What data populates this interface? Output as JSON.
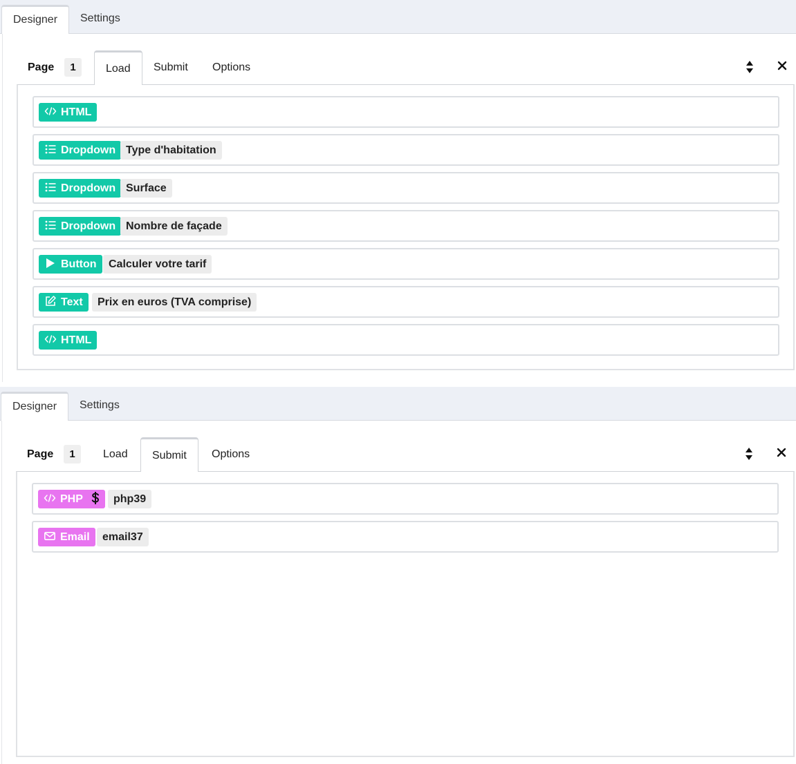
{
  "panel1": {
    "tabs": [
      "Designer",
      "Settings"
    ],
    "page_label": "Page",
    "page_number": "1",
    "subtabs": [
      "Load",
      "Submit",
      "Options"
    ],
    "active_subtab": "Load",
    "items": [
      {
        "type": "HTML",
        "icon": "code-icon",
        "label": ""
      },
      {
        "type": "Dropdown",
        "icon": "list-icon",
        "label": "Type d'habitation"
      },
      {
        "type": "Dropdown",
        "icon": "list-icon",
        "label": "Surface"
      },
      {
        "type": "Dropdown",
        "icon": "list-icon",
        "label": "Nombre de façade"
      },
      {
        "type": "Button",
        "icon": "play-icon",
        "label": "Calculer votre tarif"
      },
      {
        "type": "Text",
        "icon": "edit-icon",
        "label": "Prix en euros (TVA comprise)"
      },
      {
        "type": "HTML",
        "icon": "code-icon",
        "label": ""
      }
    ]
  },
  "panel2": {
    "tabs": [
      "Designer",
      "Settings"
    ],
    "page_label": "Page",
    "page_number": "1",
    "subtabs": [
      "Load",
      "Submit",
      "Options"
    ],
    "active_subtab": "Submit",
    "items": [
      {
        "type": "PHP",
        "icon": "code-icon",
        "extra_icon": "dollar-icon",
        "label": "php39"
      },
      {
        "type": "Email",
        "icon": "mail-icon",
        "label": "email37"
      }
    ]
  },
  "colors": {
    "teal": "#12c9a8",
    "pink": "#e874f0"
  }
}
